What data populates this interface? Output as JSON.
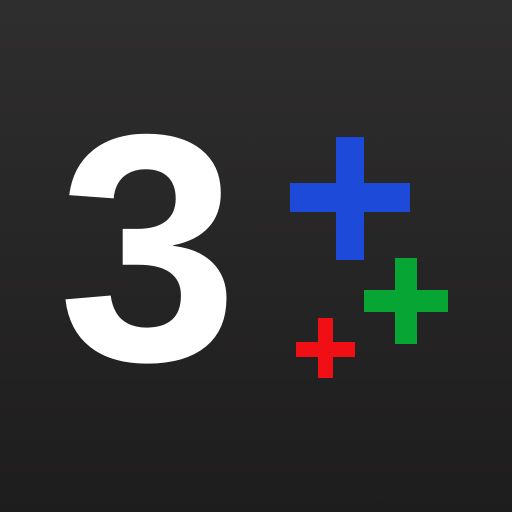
{
  "icon": {
    "glyph": "3",
    "background_top": "#2f2e2e",
    "background_bottom": "#1e1d1d",
    "glyph_color": "#ffffff"
  },
  "plus_signs": [
    {
      "name": "blue-plus-icon",
      "color": "#1d4ad8"
    },
    {
      "name": "green-plus-icon",
      "color": "#06a534"
    },
    {
      "name": "red-plus-icon",
      "color": "#ef0f14"
    }
  ]
}
